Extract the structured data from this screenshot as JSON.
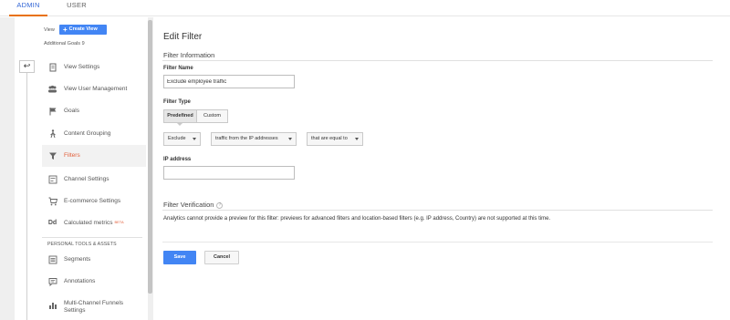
{
  "tabs": [
    {
      "label": "ADMIN",
      "active": true
    },
    {
      "label": "USER",
      "active": false
    }
  ],
  "view": {
    "label": "View",
    "create_label": "Create View",
    "name": "Additional Goals 9"
  },
  "nav": {
    "items": [
      {
        "label": "View Settings",
        "icon": "document-icon"
      },
      {
        "label": "View User Management",
        "icon": "people-icon"
      },
      {
        "label": "Goals",
        "icon": "flag-icon"
      },
      {
        "label": "Content Grouping",
        "icon": "person-walk-icon"
      },
      {
        "label": "Filters",
        "icon": "filter-icon",
        "active": true
      },
      {
        "label": "Channel Settings",
        "icon": "channel-icon"
      },
      {
        "label": "E-commerce Settings",
        "icon": "cart-icon"
      },
      {
        "label": "Calculated metrics",
        "badge": "BETA",
        "icon": "dd-icon"
      }
    ],
    "section_heading": "PERSONAL TOOLS & ASSETS",
    "tools": [
      {
        "label": "Segments",
        "icon": "segments-icon"
      },
      {
        "label": "Annotations",
        "icon": "annotation-icon"
      },
      {
        "label": "Multi-Channel Funnels Settings",
        "icon": "bar-chart-icon"
      }
    ]
  },
  "form": {
    "title": "Edit Filter",
    "section_info": "Filter Information",
    "filter_name_label": "Filter Name",
    "filter_name_value": "Exclude employee traffic",
    "filter_type_label": "Filter Type",
    "type_predefined": "Predefined",
    "type_custom": "Custom",
    "dropdowns": [
      "Exclude",
      "traffic from the IP addresses",
      "that are equal to"
    ],
    "ip_label": "IP address",
    "ip_value": "",
    "section_verification": "Filter Verification",
    "verification_text": "Analytics cannot provide a preview for this filter: previews for advanced filters and location-based filters (e.g. IP address, Country) are not supported at this time.",
    "save_label": "Save",
    "cancel_label": "Cancel"
  },
  "colors": {
    "accent_blue": "#4285f4",
    "active_orange": "#e25f3a",
    "tab_underline": "#e8710a"
  }
}
